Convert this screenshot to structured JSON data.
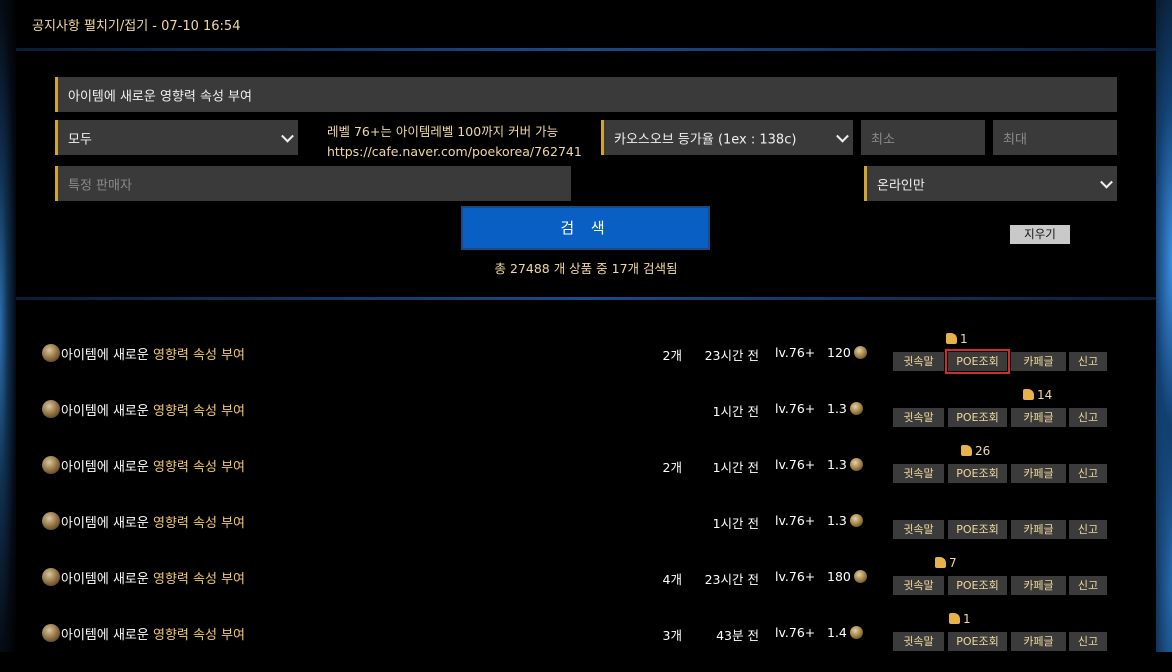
{
  "notice": {
    "text": "공지사항 펼치기/접기 - 07-10 16:54"
  },
  "search": {
    "item_name_value": "아이템에 새로운 영향력 속성 부여",
    "category_selected": "모두",
    "info_line1": "레벨 76+는 아이템레벨 100까지 커버 가능",
    "info_line2": "https://cafe.naver.com/poekorea/762741",
    "currency_selected": "카오스오브 등가율 (1ex : 138c)",
    "min_placeholder": "최소",
    "max_placeholder": "최대",
    "seller_placeholder": "특정 판매자",
    "online_selected": "온라인만",
    "search_button": "검 색",
    "clear_button": "지우기",
    "result_summary": "총 27488 개 상품 중 17개 검색됨"
  },
  "listings": [
    {
      "name_main": "아이템에 새로운 ",
      "name_accent": "영향력 속성 부여",
      "qty": "2개",
      "time": "23시간 전",
      "level": "lv.76+",
      "price": "120",
      "likes": "1",
      "highlight": true
    },
    {
      "name_main": "아이템에 새로운 ",
      "name_accent": "영향력 속성 부여",
      "qty": "",
      "time": "1시간 전",
      "level": "lv.76+",
      "price": "1.3",
      "likes": "14",
      "highlight": false
    },
    {
      "name_main": "아이템에 새로운 ",
      "name_accent": "영향력 속성 부여",
      "qty": "2개",
      "time": "1시간 전",
      "level": "lv.76+",
      "price": "1.3",
      "likes": "26",
      "highlight": false
    },
    {
      "name_main": "아이템에 새로운 ",
      "name_accent": "영향력 속성 부여",
      "qty": "",
      "time": "1시간 전",
      "level": "lv.76+",
      "price": "1.3",
      "likes": "",
      "highlight": false
    },
    {
      "name_main": "아이템에 새로운 ",
      "name_accent": "영향력 속성 부여",
      "qty": "4개",
      "time": "23시간 전",
      "level": "lv.76+",
      "price": "180",
      "likes": "7",
      "highlight": false
    },
    {
      "name_main": "아이템에 새로운 ",
      "name_accent": "영향력 속성 부여",
      "qty": "3개",
      "time": "43분 전",
      "level": "lv.76+",
      "price": "1.4",
      "likes": "1",
      "highlight": false
    }
  ],
  "actions": {
    "whisper": "귓속말",
    "poe_lookup": "POE조회",
    "cafe_post": "카페글",
    "report": "신고"
  }
}
